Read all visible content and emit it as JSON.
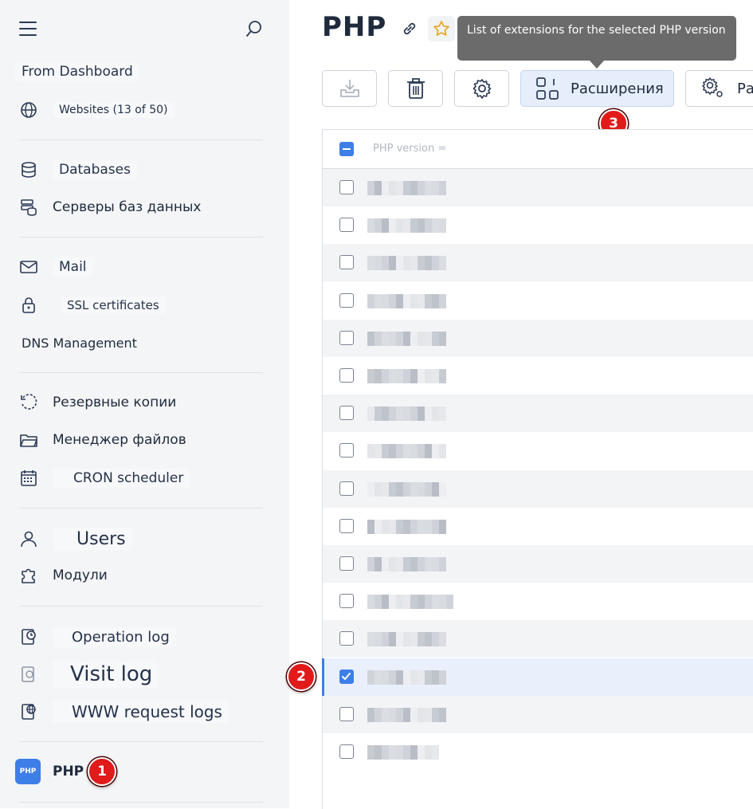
{
  "tooltip": "List of extensions for the selected PHP version",
  "page": {
    "title": "PHP"
  },
  "sidebar": {
    "items": [
      {
        "label": "From Dashboard",
        "icon": "dashboard-icon"
      },
      {
        "label": "Websites (13 of 50)",
        "icon": "globe-icon"
      },
      {
        "label": "Databases",
        "icon": "database-icon"
      },
      {
        "label": "Серверы баз данных",
        "icon": "db-servers-icon"
      },
      {
        "label": "Mail",
        "icon": "mail-icon"
      },
      {
        "label": "SSL certificates",
        "icon": "lock-icon"
      },
      {
        "label": "DNS Management",
        "icon": "dns-icon"
      },
      {
        "label": "Резервные копии",
        "icon": "backup-icon"
      },
      {
        "label": "Менеджер файлов",
        "icon": "folder-icon"
      },
      {
        "label": "CRON scheduler",
        "icon": "calendar-icon"
      },
      {
        "label": "Users",
        "icon": "user-icon"
      },
      {
        "label": "Модули",
        "icon": "puzzle-icon"
      },
      {
        "label": "Operation log",
        "icon": "operation-log-icon"
      },
      {
        "label": "Visit log",
        "icon": "visit-log-icon"
      },
      {
        "label": "WWW request logs",
        "icon": "www-log-icon"
      },
      {
        "label": "PHP",
        "icon": "php-icon"
      }
    ]
  },
  "toolbar": {
    "extensions_label": "Расширения",
    "next_label": "Рас"
  },
  "table": {
    "header": "PHP version ="
  },
  "markers": [
    "1",
    "2",
    "3"
  ],
  "colors": {
    "accent": "#3e7ee8",
    "marker": "#e11a1a",
    "tooltip": "#6b6b6b"
  }
}
